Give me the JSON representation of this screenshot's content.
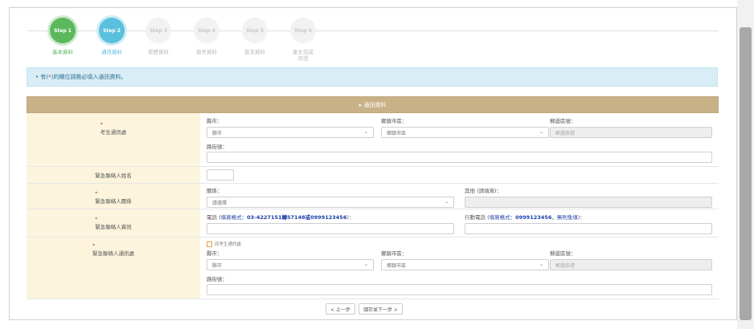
{
  "steps": [
    {
      "num": "Step 1",
      "label": "基本資料",
      "state": "done"
    },
    {
      "num": "Step 2",
      "label": "通訊資料",
      "state": "active"
    },
    {
      "num": "Step 3",
      "label": "學歷資料",
      "state": "todo"
    },
    {
      "num": "Step 4",
      "label": "報考資料",
      "state": "todo"
    },
    {
      "num": "Step 5",
      "label": "需求資料",
      "state": "todo"
    },
    {
      "num": "Step 6",
      "label": "產生完成",
      "label2": "存證",
      "state": "todo"
    }
  ],
  "alert": {
    "bullet": "•",
    "pre": "有(",
    "star": "*",
    "post": ")的欄位請務必填入通訊資料。"
  },
  "table": {
    "header_icon": "▸",
    "header": "通訊資料",
    "rows": {
      "address": {
        "label_star": "*",
        "label": "考生通訊處",
        "county_label": "縣市：",
        "county_value": "縣市",
        "town_label": "鄉鎮市區：",
        "town_value": "鄉鎮市區",
        "zip_label": "郵遞區號：",
        "zip_placeholder": "郵遞區號",
        "street_label": "路街號："
      },
      "contact_name": {
        "label": "緊急聯絡人姓名"
      },
      "relation": {
        "label_star": "*",
        "label": "緊急聯絡人關係",
        "relation_label": "關係：",
        "relation_value": "請選擇",
        "other_label": "其他 (請填寫)："
      },
      "contact_info": {
        "label_star": "*",
        "label": "緊急聯絡人資訊",
        "phone_label": "電話",
        "phone_hint_open": " (",
        "phone_hint_text": "填寫格式：",
        "phone_hint_value": "03-4227151轉57148或0999123456",
        "phone_hint_close": ")：",
        "mobile_label": "行動電話",
        "mobile_hint_open": " (",
        "mobile_hint_text": "填寫格式：",
        "mobile_hint_value": "0999123456",
        "mobile_hint_tail": "，無則免填",
        "mobile_hint_close": ")："
      },
      "contact_address": {
        "label_star": "*",
        "label": "緊急聯絡人通訊處",
        "same_label": "同考生通訊處",
        "county_label": "縣市：",
        "county_value": "縣市",
        "town_label": "鄉鎮市區：",
        "town_value": "鄉鎮市區",
        "zip_label": "郵遞區號：",
        "zip_placeholder": "郵遞區號",
        "street_label": "路街號："
      }
    }
  },
  "nav": {
    "prev": "< 上一步",
    "next": "儲存並下一步 >"
  },
  "icons": {
    "chevron": "⌄"
  },
  "colors": {
    "done": "#5cb85c",
    "active": "#5bc0de",
    "header": "#c9b187",
    "label_bg": "#fcf4dd",
    "alert_bg": "#d9edf7"
  }
}
